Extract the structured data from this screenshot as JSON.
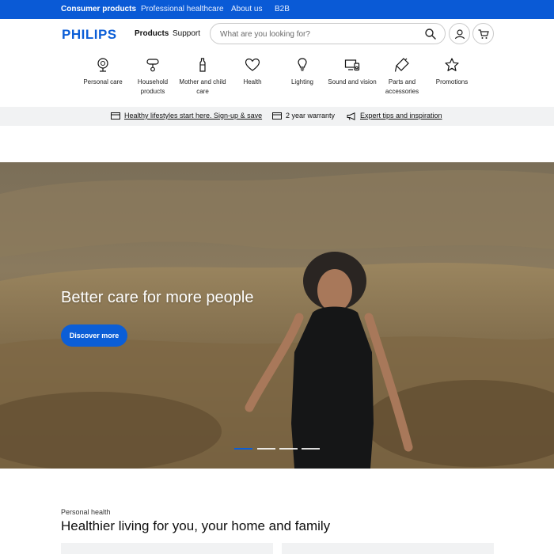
{
  "topbar": {
    "links": [
      {
        "label": "Consumer products",
        "active": true
      },
      {
        "label": "Professional healthcare",
        "active": false
      },
      {
        "label": "About us",
        "active": false
      },
      {
        "label": "B2B",
        "active": false
      }
    ],
    "color": "#0b5ed7"
  },
  "header": {
    "logo": "PHILIPS",
    "nav": [
      "Products",
      "Support"
    ],
    "search": {
      "placeholder": "What are you looking for?",
      "value": ""
    },
    "icons": [
      "search-icon",
      "account-icon",
      "cart-icon"
    ]
  },
  "categories": [
    {
      "label": "Personal care",
      "icon": "shaver-icon"
    },
    {
      "label": "Household products",
      "icon": "iron-icon"
    },
    {
      "label": "Mother and child care",
      "icon": "bottle-icon"
    },
    {
      "label": "Health",
      "icon": "heart-icon"
    },
    {
      "label": "Lighting",
      "icon": "bulb-icon"
    },
    {
      "label": "Sound and vision",
      "icon": "tv-speaker-icon"
    },
    {
      "label": "Parts and accessories",
      "icon": "accessory-icon"
    },
    {
      "label": "Promotions",
      "icon": "star-icon"
    }
  ],
  "usp": [
    {
      "label": "Healthy lifestyles start here. Sign-up & save",
      "icon": "card-icon",
      "link": true
    },
    {
      "label": "2 year warranty",
      "icon": "card-icon",
      "link": false
    },
    {
      "label": "Expert tips and inspiration",
      "icon": "megaphone-icon",
      "link": true
    }
  ],
  "hero": {
    "title": "Better care for more people",
    "button": "Discover more",
    "slides": 4,
    "active_slide": 1
  },
  "section": {
    "kicker": "Personal health",
    "title": "Healthier living for you, your home and family"
  }
}
